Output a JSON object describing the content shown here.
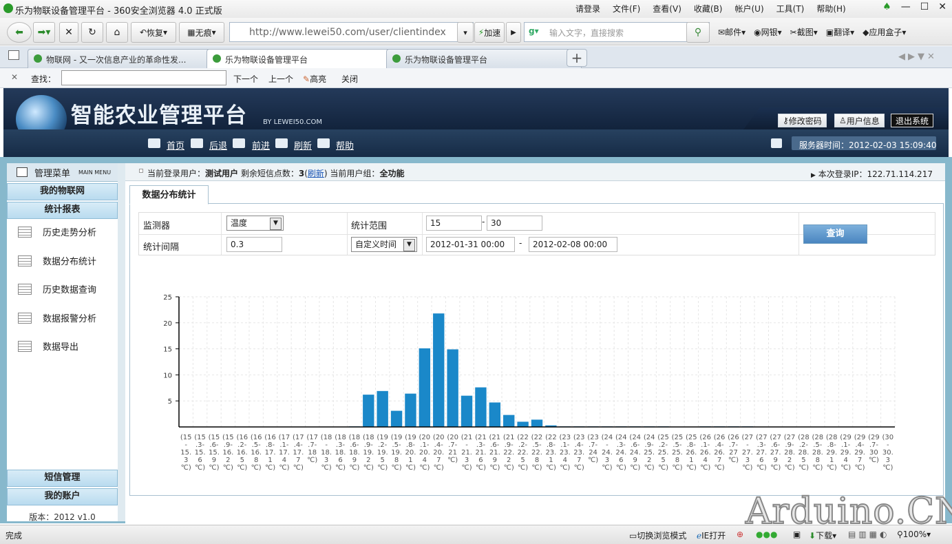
{
  "browser": {
    "title": "乐为物联设备管理平台 - 360安全浏览器 4.0 正式版",
    "menu": [
      "请登录",
      "文件(F)",
      "查看(V)",
      "收藏(B)",
      "帐户(U)",
      "工具(T)",
      "帮助(H)"
    ],
    "restore": "恢复",
    "notrace": "无痕",
    "url": "http://www.lewei50.com/user/clientindex",
    "speedup": "加速",
    "search_placeholder": "输入文字，直接搜索",
    "right_links": [
      "邮件",
      "网银",
      "截图",
      "翻译",
      "应用盒子"
    ],
    "tabs": [
      "物联网 - 又一次信息产业的革命性发...",
      "乐为物联设备管理平台",
      "乐为物联设备管理平台"
    ],
    "find": {
      "label": "查找：",
      "next": "下一个",
      "prev": "上一个",
      "highlight": "高亮",
      "close": "关闭"
    },
    "status": {
      "done": "完成",
      "switch_mode": "切换浏览模式",
      "ie_open": "IE打开",
      "download": "下载",
      "zoom": "100%"
    }
  },
  "app": {
    "title": "智能农业管理平台",
    "by": "BY LEWEI50.COM",
    "buttons": {
      "change_password": "修改密码",
      "user_info": "用户信息",
      "logout": "退出系统"
    },
    "nav": [
      "首页",
      "后退",
      "前进",
      "刷新",
      "帮助"
    ],
    "server_time_label": "服务器时间：",
    "server_time": "2012-02-03 15:09:40"
  },
  "sidebar": {
    "title": "管理菜单",
    "title_en": "MAIN MENU",
    "sections_top": [
      "我的物联网",
      "统计报表"
    ],
    "items": [
      "历史走势分析",
      "数据分布统计",
      "历史数据查询",
      "数据报警分析",
      "数据导出"
    ],
    "sections_bottom": [
      "短信管理",
      "我的账户"
    ],
    "version": "版本：2012 v1.0"
  },
  "infobar": {
    "user_label": "当前登录用户：",
    "user": "测试用户",
    "sms_label": " 剩余短信点数：",
    "sms": "3",
    "refresh": "刷新",
    "group_label": " 当前用户组：",
    "group": "全功能",
    "ip_label": "本次登录IP：",
    "ip": "122.71.114.217"
  },
  "panel": {
    "tab": "数据分布统计",
    "monitor_label": "监测器",
    "monitor_value": "温度",
    "range_label": "统计范围",
    "range_from": "15",
    "range_to": "30",
    "dash": "-",
    "interval_label": "统计间隔",
    "interval_value": "0.3",
    "time_mode": "自定义时间",
    "time_from": "2012-01-31 00:00",
    "time_to": "2012-02-08 00:00",
    "query": "查询"
  },
  "watermark": "Arduino.CN",
  "chart_data": {
    "type": "bar",
    "ylim": [
      0,
      25
    ],
    "yticks": [
      5,
      10,
      15,
      20,
      25
    ],
    "grid": true,
    "categories": [
      [
        "(15",
        "-",
        "15.",
        "3",
        "℃)"
      ],
      [
        "(15",
        ".3-",
        "15.",
        "6",
        "℃)"
      ],
      [
        "(15",
        ".6-",
        "15.",
        "9",
        "℃)"
      ],
      [
        "(15",
        ".9-",
        "16.",
        "2",
        "℃)"
      ],
      [
        "(16",
        ".2-",
        "16.",
        "5",
        "℃)"
      ],
      [
        "(16",
        ".5-",
        "16.",
        "8",
        "℃)"
      ],
      [
        "(16",
        ".8-",
        "17.",
        "1",
        "℃)"
      ],
      [
        "(17",
        ".1-",
        "17.",
        "4",
        "℃)"
      ],
      [
        "(17",
        ".4-",
        "17.",
        "7",
        "℃)"
      ],
      [
        "(17",
        ".7-",
        "18",
        "℃)"
      ],
      [
        "(18",
        "-",
        "18.",
        "3",
        "℃)"
      ],
      [
        "(18",
        ".3-",
        "18.",
        "6",
        "℃)"
      ],
      [
        "(18",
        ".6-",
        "18.",
        "9",
        "℃)"
      ],
      [
        "(18",
        ".9-",
        "19.",
        "2",
        "℃)"
      ],
      [
        "(19",
        ".2-",
        "19.",
        "5",
        "℃)"
      ],
      [
        "(19",
        ".5-",
        "19.",
        "8",
        "℃)"
      ],
      [
        "(19",
        ".8-",
        "20.",
        "1",
        "℃)"
      ],
      [
        "(20",
        ".1-",
        "20.",
        "4",
        "℃)"
      ],
      [
        "(20",
        ".4-",
        "20.",
        "7",
        "℃)"
      ],
      [
        "(20",
        ".7-",
        "21",
        "℃)"
      ],
      [
        "(21",
        "-",
        "21.",
        "3",
        "℃)"
      ],
      [
        "(21",
        ".3-",
        "21.",
        "6",
        "℃)"
      ],
      [
        "(21",
        ".6-",
        "21.",
        "9",
        "℃)"
      ],
      [
        "(21",
        ".9-",
        "22.",
        "2",
        "℃)"
      ],
      [
        "(22",
        ".2-",
        "22.",
        "5",
        "℃)"
      ],
      [
        "(22",
        ".5-",
        "22.",
        "8",
        "℃)"
      ],
      [
        "(22",
        ".8-",
        "23.",
        "1",
        "℃)"
      ],
      [
        "(23",
        ".1-",
        "23.",
        "4",
        "℃)"
      ],
      [
        "(23",
        ".4-",
        "23.",
        "7",
        "℃)"
      ],
      [
        "(23",
        ".7-",
        "24",
        "℃)"
      ],
      [
        "(24",
        "-",
        "24.",
        "3",
        "℃)"
      ],
      [
        "(24",
        ".3-",
        "24.",
        "6",
        "℃)"
      ],
      [
        "(24",
        ".6-",
        "24.",
        "9",
        "℃)"
      ],
      [
        "(24",
        ".9-",
        "25.",
        "2",
        "℃)"
      ],
      [
        "(25",
        ".2-",
        "25.",
        "5",
        "℃)"
      ],
      [
        "(25",
        ".5-",
        "25.",
        "8",
        "℃)"
      ],
      [
        "(25",
        ".8-",
        "26.",
        "1",
        "℃)"
      ],
      [
        "(26",
        ".1-",
        "26.",
        "4",
        "℃)"
      ],
      [
        "(26",
        ".4-",
        "26.",
        "7",
        "℃)"
      ],
      [
        "(26",
        ".7-",
        "27",
        "℃)"
      ],
      [
        "(27",
        "-",
        "27.",
        "3",
        "℃)"
      ],
      [
        "(27",
        ".3-",
        "27.",
        "6",
        "℃)"
      ],
      [
        "(27",
        ".6-",
        "27.",
        "9",
        "℃)"
      ],
      [
        "(27",
        ".9-",
        "28.",
        "2",
        "℃)"
      ],
      [
        "(28",
        ".2-",
        "28.",
        "5",
        "℃)"
      ],
      [
        "(28",
        ".5-",
        "28.",
        "8",
        "℃)"
      ],
      [
        "(28",
        ".8-",
        "29.",
        "1",
        "℃)"
      ],
      [
        "(29",
        ".1-",
        "29.",
        "4",
        "℃)"
      ],
      [
        "(29",
        ".4-",
        "29.",
        "7",
        "℃)"
      ],
      [
        "(29",
        ".7-",
        "30",
        "℃)"
      ],
      [
        "(30",
        "-",
        "30.",
        "3",
        "℃)"
      ]
    ],
    "values": [
      0,
      0,
      0,
      0,
      0,
      0,
      0,
      0,
      0,
      0,
      0,
      0,
      0.1,
      6.2,
      6.9,
      3.1,
      6.4,
      15.1,
      21.8,
      14.9,
      6.0,
      7.6,
      4.7,
      2.3,
      1.0,
      1.4,
      0.3,
      0.1,
      0.1,
      0.1,
      0.1,
      0.1,
      0.1,
      0.1,
      0.1,
      0,
      0,
      0.1,
      0.1,
      0.1,
      0.1,
      0,
      0,
      0,
      0,
      0,
      0,
      0,
      0,
      0,
      0
    ]
  }
}
